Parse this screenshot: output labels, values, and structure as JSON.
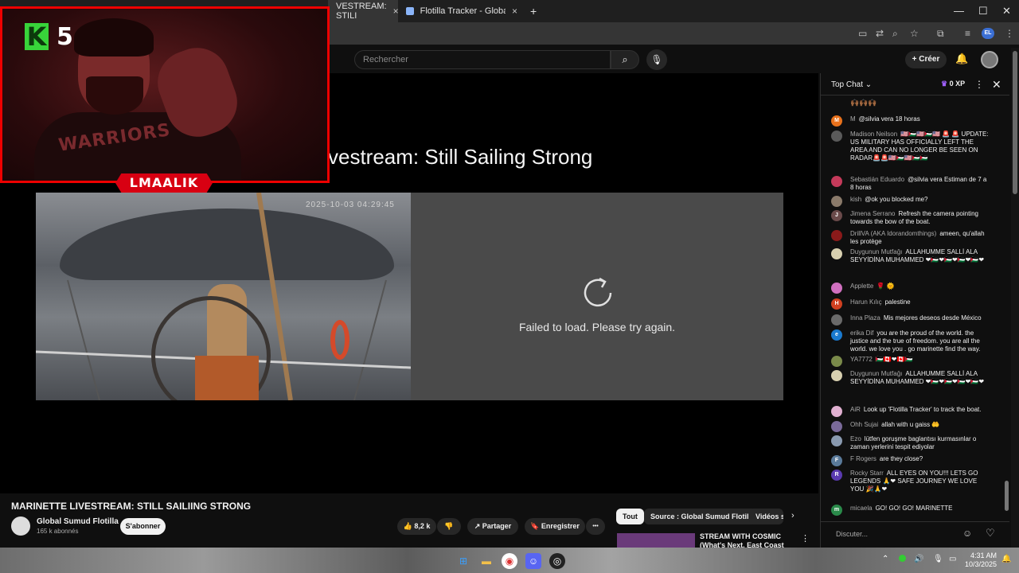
{
  "browser": {
    "tabs": [
      {
        "label": "VESTREAM: STILI",
        "close": "×"
      },
      {
        "label": "Flotilla Tracker - Global Movem",
        "close": "×"
      }
    ],
    "new_tab": "+",
    "window": {
      "minimize": "—",
      "maximize": "☐",
      "close": "✕"
    },
    "profile_badge": "EL"
  },
  "youtube": {
    "search_placeholder": "Rechercher",
    "create_label": "Créer",
    "video_heading": "vestream: Still Sailing Strong",
    "camera_timestamp": "2025-10-03 04:29:45",
    "error_message": "Failed to load. Please try again.",
    "title": "MARINETTE LIVESTREAM: STILL SAILIING STRONG",
    "channel": {
      "name": "Global Sumud Flotilla",
      "subs": "165 k abonnés",
      "subscribe": "S'abonner"
    },
    "actions": {
      "likes": "8,2 k",
      "share": "Partager",
      "save": "Enregistrer",
      "more": "•••"
    },
    "chips": [
      "Tout",
      "Source : Global Sumud Flotilla",
      "Vidéos s"
    ],
    "recommended": {
      "title": "STREAM WITH COSMIC (What's Next, East Coast Story, AI"
    }
  },
  "stream_overlay": {
    "logo_letter": "K",
    "level": "5",
    "shirt_text": "WARRIORS",
    "streamer_name": "LMAALIK"
  },
  "chat": {
    "header": "Top Chat",
    "xp": "0 XP",
    "input_placeholder": "Discuter...",
    "messages": [
      {
        "author": "M",
        "text": "@silvia vera 18 horas",
        "initial": "M",
        "color": "#e8711c"
      },
      {
        "author": "Madison Neilson",
        "text": "🇺🇸🇵🇸🇺🇸🇵🇸🇺🇸 🚨 🚨 UPDATE: US MILITARY HAS OFFICIALLY LEFT THE AREA AND CAN NO LONGER BE SEEN ON RADAR🚨🚨🇺🇸🇵🇸🇺🇸🇵🇸🇵🇸",
        "initial": "",
        "color": "#5a5a5a"
      },
      {
        "author": "Sebastián Eduardo",
        "text": "@silvia vera Estiman de 7 a 8 horas",
        "initial": "",
        "color": "#c43a5a"
      },
      {
        "author": "kish",
        "text": "@ok you blocked me?",
        "initial": "",
        "color": "#8a7a6a"
      },
      {
        "author": "Jimena Serrano",
        "text": "Refresh the camera pointing towards the bow of the boat.",
        "initial": "J",
        "color": "#6a4a4a"
      },
      {
        "author": "DrillVA (AKA Idorandomthings)",
        "text": "ameen, qu'allah les protège",
        "initial": "",
        "color": "#8a1a1a"
      },
      {
        "author": "Duygunun Mutfağı",
        "text": "ALLAHUMME SALLİ ALA SEYYİDİNA MUHAMMED ❤🇵🇸❤🇵🇸❤🇵🇸❤🇵🇸❤",
        "initial": "",
        "color": "#d8d0b0"
      },
      {
        "author": "Applette",
        "text": "🌹 🌞",
        "initial": "",
        "color": "#d070c0"
      },
      {
        "author": "Harun Kılıç",
        "text": "palestine",
        "initial": "H",
        "color": "#d04020"
      },
      {
        "author": "Inna Plaza",
        "text": "Mis mejores deseos desde México",
        "initial": "",
        "color": "#6a6a6a"
      },
      {
        "author": "erika Dif",
        "text": "you are the proud of the world. the justice and the true of freedom. you are all the world. we love you . go marinette find the way.",
        "initial": "e",
        "color": "#1a7ad0"
      },
      {
        "author": "YA7772",
        "text": "🇵🇸🇨🇦❤🇨🇦🇵🇸",
        "initial": "",
        "color": "#7a8a4a"
      },
      {
        "author": "Duygunun Mutfağı",
        "text": "ALLAHUMME SALLİ ALA SEYYİDİNA MUHAMMED ❤🇵🇸❤🇵🇸❤🇵🇸❤🇵🇸❤",
        "initial": "",
        "color": "#d8d0b0"
      },
      {
        "author": "AiR",
        "text": "Look up 'Flotilla Tracker' to track the boat.",
        "initial": "",
        "color": "#e0b0d0"
      },
      {
        "author": "Ohh Sujai",
        "text": "allah with u gaiss 🤲",
        "initial": "",
        "color": "#7a6a9a"
      },
      {
        "author": "Ezo",
        "text": "lütfen goruşme baglantısı kurmasınlar o zaman yerlerini tespit ediyolar",
        "initial": "",
        "color": "#8a9ab0"
      },
      {
        "author": "F Rogers",
        "text": "are they close?",
        "initial": "F",
        "color": "#5a7a9a"
      },
      {
        "author": "Rocky Starr",
        "text": "ALL EYES ON YOU!!! LETS GO LEGENDS 🙏❤ SAFE JOURNEY WE LOVE YOU 🎉🙏❤",
        "initial": "R",
        "color": "#5a3ab0"
      },
      {
        "author": "micaela",
        "text": "GO! GO! GO! MARINETTE",
        "initial": "m",
        "color": "#2a8a4a"
      }
    ]
  },
  "taskbar": {
    "time": "4:31 AM",
    "date": "10/3/2025"
  }
}
